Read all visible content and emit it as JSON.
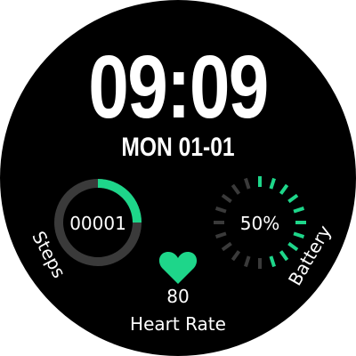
{
  "watch_face": {
    "time": "09:09",
    "date": "MON 01-01",
    "accent_color": "#1ed68a",
    "track_color": "#3a3a3a",
    "background_color": "#000000",
    "steps": {
      "value": "00001",
      "label": "Steps",
      "progress_fraction": 0.25
    },
    "battery": {
      "value": "50%",
      "label": "Battery",
      "level_fraction": 0.5
    },
    "heart_rate": {
      "value": "80",
      "label": "Heart Rate",
      "icon": "heart-icon"
    }
  }
}
